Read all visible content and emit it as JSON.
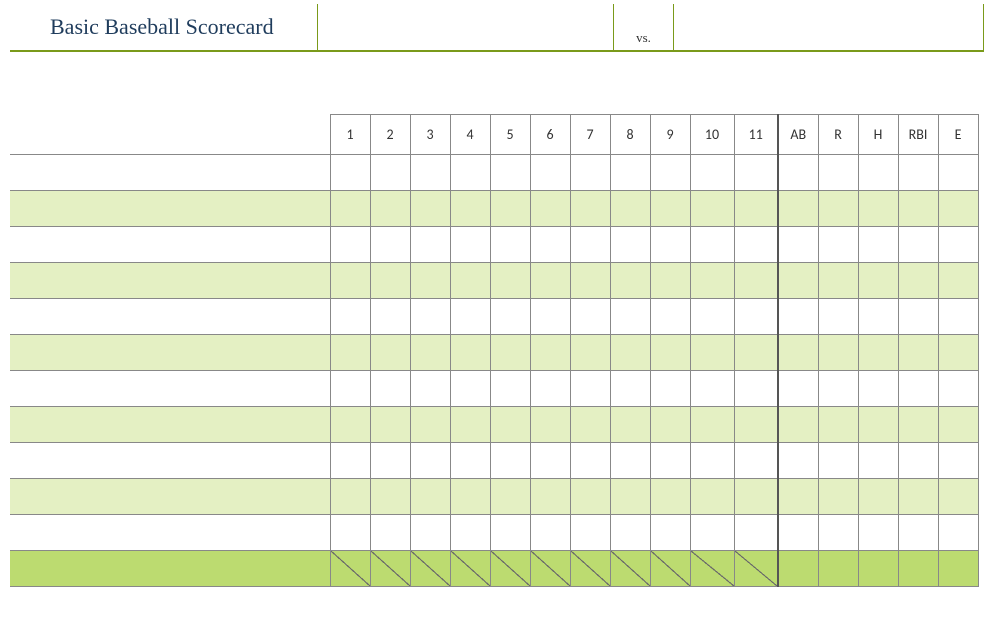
{
  "header": {
    "title": "Basic Baseball Scorecard",
    "vs_label": "vs.",
    "team_home": "",
    "team_away": ""
  },
  "columns": {
    "innings": [
      "1",
      "2",
      "3",
      "4",
      "5",
      "6",
      "7",
      "8",
      "9",
      "10",
      "11"
    ],
    "stats": [
      "AB",
      "R",
      "H",
      "RBI",
      "E"
    ]
  },
  "rows": {
    "player_count": 11,
    "shaded_indices": [
      2,
      4,
      6,
      8,
      10
    ],
    "totals_row": true
  },
  "colors": {
    "accent": "#7a9a1a",
    "shade_light": "#e4f0c3",
    "shade_totals": "#bcdb70"
  }
}
